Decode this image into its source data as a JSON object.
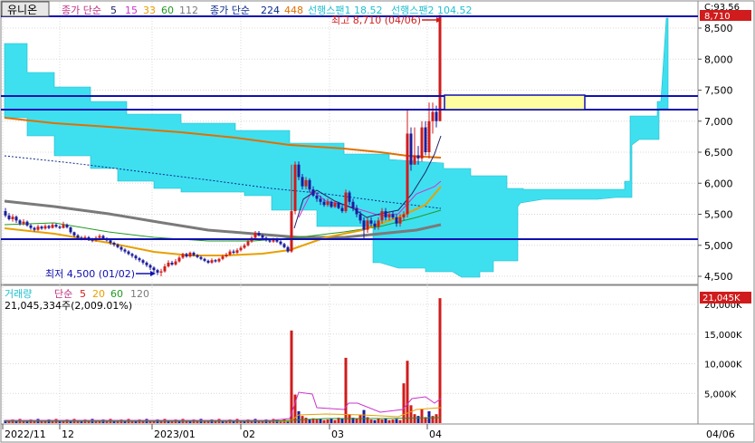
{
  "price_header": {
    "title": "유니온",
    "ma_label": "종가 단순",
    "ma_periods": [
      "5",
      "15",
      "33",
      "60",
      "112"
    ],
    "ma2_label": "종가 단순",
    "ma2_periods": [
      "224",
      "448"
    ],
    "span1": "선행스팬1 18.52",
    "span2": "선행스팬2 104.52"
  },
  "volume_header": {
    "label": "거래량",
    "ma_label": "단순",
    "periods": [
      "5",
      "20",
      "60",
      "120"
    ],
    "current": "21,045,334주(2,009.01%)"
  },
  "annotations": {
    "high": "최고 8,710 (04/06)",
    "low": "최저 4,500 (01/02)"
  },
  "price_axis": {
    "ticks": [
      "8,500",
      "8,000",
      "7,500",
      "7,000",
      "6,500",
      "6,000",
      "5,500",
      "5,000",
      "4,500"
    ],
    "current_badge": "8,710",
    "corner": "C:93.56"
  },
  "volume_axis": {
    "ticks": [
      "20,000K",
      "15,000K",
      "10,000K",
      "5,000K"
    ],
    "current_badge": "21,045K"
  },
  "x_axis": {
    "ticks": [
      "2022/11",
      "12",
      "2023/01",
      "02",
      "03",
      "04"
    ],
    "current_date": "04/06"
  },
  "colors": {
    "up": "#d01c1c",
    "down": "#1c1c9c",
    "cloud": "#3ee0f0",
    "ma5": "#222266",
    "ma15": "#cc33cc",
    "ma33": "#e8a000",
    "ma60": "#229922",
    "ma112": "#7a7a7a",
    "ma224": "#0a2a8a",
    "ma448": "#e07000",
    "hline": "#1010b0",
    "box_fill": "#ffffa0"
  }
}
